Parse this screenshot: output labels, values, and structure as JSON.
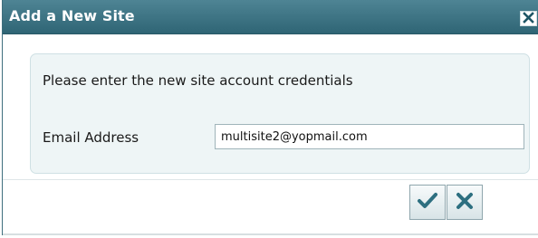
{
  "dialog": {
    "title": "Add a New Site",
    "prompt": "Please enter the new site account credentials",
    "email": {
      "label": "Email Address",
      "value": "multisite2@yopmail.com"
    }
  },
  "icons": {
    "close": "close-icon",
    "ok": "checkmark-icon",
    "cancel": "x-icon"
  },
  "colors": {
    "titlebar": "#346b7b",
    "accent": "#2d6f80"
  }
}
